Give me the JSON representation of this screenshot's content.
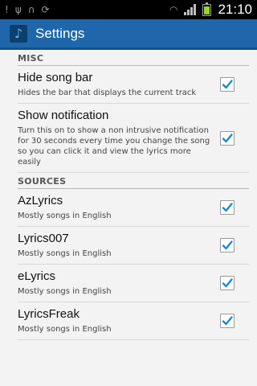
{
  "status_bar": {
    "time": "21:10",
    "icons": [
      "alert-icon",
      "usb-icon",
      "headphones-icon",
      "sync-icon",
      "wifi-icon",
      "signal-icon",
      "battery-icon"
    ]
  },
  "action_bar": {
    "title": "Settings",
    "app_icon": "music-note-icon"
  },
  "sections": [
    {
      "header": "MISC",
      "items": [
        {
          "title": "Hide song bar",
          "summary": "Hides the bar that displays the current track",
          "checked": true
        },
        {
          "title": "Show notification",
          "summary": "Turn this on to show a non intrusive notification for 30 seconds every time you change the song so you can click it and view the lyrics more easily",
          "checked": true
        }
      ]
    },
    {
      "header": "SOURCES",
      "items": [
        {
          "title": "AzLyrics",
          "summary": "Mostly songs in English",
          "checked": true
        },
        {
          "title": "Lyrics007",
          "summary": "Mostly songs in English",
          "checked": true
        },
        {
          "title": "eLyrics",
          "summary": "Mostly songs in English",
          "checked": true
        },
        {
          "title": "LyricsFreak",
          "summary": "Mostly songs in English",
          "checked": true
        }
      ]
    }
  ],
  "colors": {
    "action_bar": "#1f67aa",
    "check": "#1b8ad0"
  }
}
